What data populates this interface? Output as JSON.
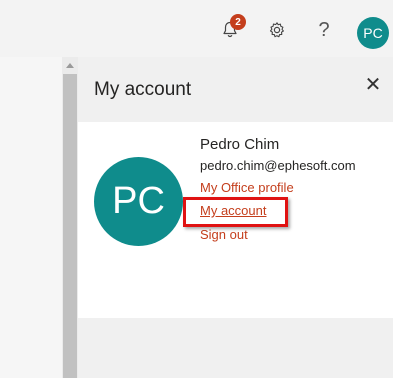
{
  "header": {
    "notification_count": "2",
    "help_label": "?",
    "avatar_initials": "PC",
    "icons": [
      "bell-icon",
      "gear-icon",
      "help-icon"
    ]
  },
  "account_panel": {
    "title": "My account",
    "close_label": "✕",
    "avatar_initials": "PC",
    "user_name": "Pedro Chim",
    "user_email": "pedro.chim@ephesoft.com",
    "links": {
      "office_profile": "My Office profile",
      "my_account": "My account",
      "sign_out": "Sign out"
    },
    "link_color": "#c43e1c",
    "avatar_color": "#0f8c8c",
    "highlight_color": "#e01212"
  }
}
